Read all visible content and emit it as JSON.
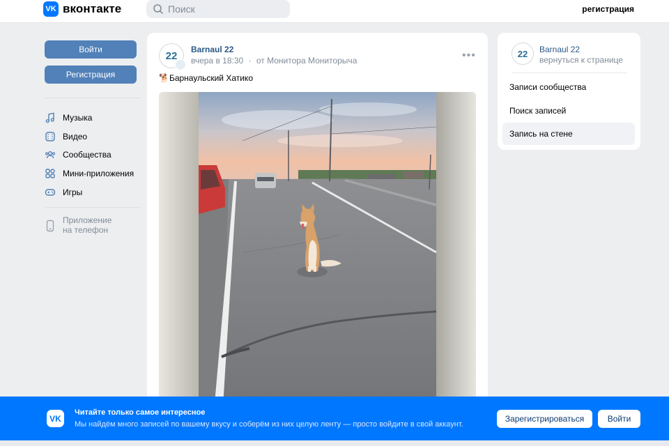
{
  "header": {
    "logo_badge": "VK",
    "logo_text": "вконтакте",
    "search_placeholder": "Поиск",
    "register_link": "регистрация"
  },
  "left": {
    "login_button": "Войти",
    "register_button": "Регистрация",
    "nav": [
      {
        "label": "Музыка",
        "icon": "music-icon"
      },
      {
        "label": "Видео",
        "icon": "video-icon"
      },
      {
        "label": "Сообщества",
        "icon": "communities-icon"
      },
      {
        "label": "Мини-приложения",
        "icon": "mini-apps-icon"
      },
      {
        "label": "Игры",
        "icon": "games-icon"
      }
    ],
    "app_link_line1": "Приложение",
    "app_link_line2": "на телефон"
  },
  "post": {
    "avatar_text": "22",
    "author": "Barnaul 22",
    "time": "вчера в 18:30",
    "dot": "·",
    "from": "от Монитора Мониторыча",
    "more": "•••",
    "emoji": "🐕",
    "text": "Барнаульский Хатико"
  },
  "side": {
    "avatar_text": "22",
    "name": "Barnaul 22",
    "back": "вернуться к странице",
    "items": [
      "Записи сообщества",
      "Поиск записей",
      "Запись на стене"
    ]
  },
  "banner": {
    "logo": "VK",
    "title": "Читайте только самое интересное",
    "subtitle": "Мы найдём много записей по вашему вкусу и соберём из них целую ленту — просто войдите в свой аккаунт.",
    "register_button": "Зарегистрироваться",
    "login_button": "Войти"
  },
  "colors": {
    "accent": "#0077ff",
    "button": "#5181b8",
    "link": "#2a5885",
    "muted": "#818c99",
    "background": "#edeef0"
  }
}
